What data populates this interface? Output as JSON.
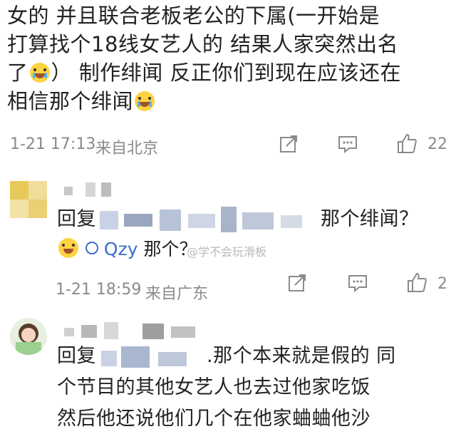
{
  "post": {
    "lines": [
      "女的  并且联合老板老公的下属(一开始是",
      "打算找个18线女艺人的  结果人家突然出名",
      "了",
      "）  制作绯闻  反正你们到现在应该还在",
      "相信那个绯闻"
    ],
    "time": "1-21 17:13",
    "location": "来自北京",
    "like_count": "22"
  },
  "reply1": {
    "prefix": "回复",
    "suffix": "那个绯闻？",
    "mention": "Qzy",
    "mention_text": "那个？",
    "watermark": "@学不会玩滑板",
    "time": "1-21 18:59",
    "location": "来自广东",
    "like_count": "2"
  },
  "reply2": {
    "prefix": "回复",
    "lines": [
      ".那个本来就是假的  同",
      "个节目的其他女艺人也去过他家吃饭",
      "然后他还说他们几个在他家蛐蛐他沙"
    ]
  },
  "icons": {
    "share": "share-icon",
    "comment": "comment-icon",
    "like": "thumbs-up-icon",
    "emoji": "crying-laughing-emoji-icon",
    "laugh": "laughing-emoji-icon"
  }
}
